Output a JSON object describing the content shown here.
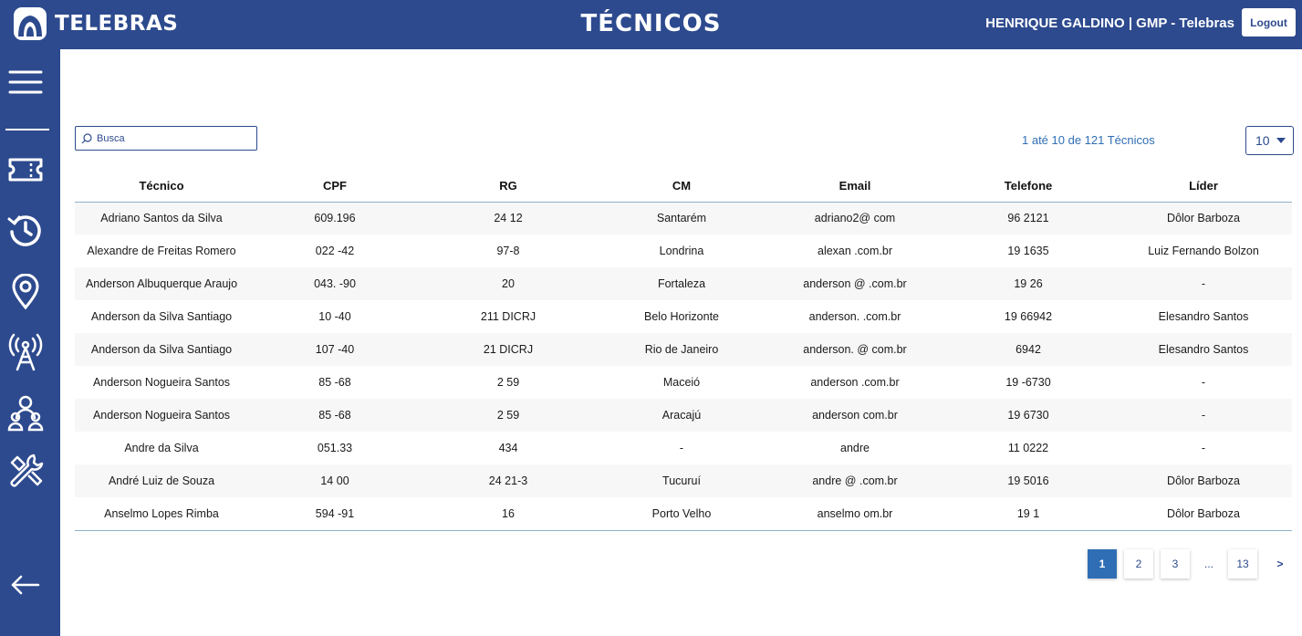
{
  "header": {
    "brand": "TELEBRAS",
    "title": "TÉCNICOS",
    "user": "HENRIQUE GALDINO | GMP - Telebras",
    "logout": "Logout"
  },
  "sidebar": {
    "icons": [
      "menu-icon",
      "ticket-icon",
      "history-icon",
      "location-pin-icon",
      "antenna-icon",
      "users-icon",
      "tools-icon",
      "arrow-left-icon"
    ]
  },
  "search": {
    "placeholder": "Busca",
    "value": ""
  },
  "listing": {
    "range": "1 até 10 de 121 Técnicos",
    "page_size": "10"
  },
  "table": {
    "headers": [
      "Técnico",
      "CPF",
      "RG",
      "CM",
      "Email",
      "Telefone",
      "Líder"
    ],
    "rows": [
      [
        "Adriano Santos da Silva",
        "609.196",
        "24   12",
        "Santarém",
        "adriano2@            com",
        "96              2121",
        "Dôlor Barboza"
      ],
      [
        "Alexandre de Freitas Romero",
        "022                 -42",
        "97-8",
        "Londrina",
        "alexan                     .com.br",
        "19             1635",
        "Luiz Fernando Bolzon"
      ],
      [
        "Anderson Albuquerque Araujo",
        "043.                -90",
        "20",
        "Fortaleza",
        "anderson      @       .com.br",
        "19           26",
        "-"
      ],
      [
        "Anderson da Silva Santiago",
        "10                  -40",
        "211          DICRJ",
        "Belo Horizonte",
        "anderson.                   .com.br",
        "19           66942",
        "Elesandro Santos"
      ],
      [
        "Anderson da Silva Santiago",
        "107                 -40",
        "21           DICRJ",
        "Rio de Janeiro",
        "anderson.        @         com.br",
        "6942",
        "Elesandro Santos"
      ],
      [
        "Anderson Nogueira Santos",
        "85                  -68",
        "2    59",
        "Maceió",
        "anderson                  .com.br",
        "19             -6730",
        "-"
      ],
      [
        "Anderson Nogueira Santos",
        "85                  -68",
        "2    59",
        "Aracajú",
        "anderson                  com.br",
        "19             6730",
        "-"
      ],
      [
        "Andre da Silva",
        "051.33",
        "434",
        "-",
        "andre",
        "11          0222",
        "-"
      ],
      [
        "André Luiz de Souza",
        "14                  00",
        "24        21-3",
        "Tucuruí",
        "andre        @          .com.br",
        "19            5016",
        "Dôlor Barboza"
      ],
      [
        "Anselmo Lopes Rimba",
        "594                 -91",
        "16",
        "Porto Velho",
        "anselmo                    om.br",
        "19                 1",
        "Dôlor Barboza"
      ]
    ]
  },
  "pagination": {
    "pages": [
      "1",
      "2",
      "3",
      "...",
      "13"
    ],
    "active": "1",
    "next": ">"
  },
  "colors": {
    "brand": "#2d4a8e",
    "accent": "#2f6eb5"
  }
}
